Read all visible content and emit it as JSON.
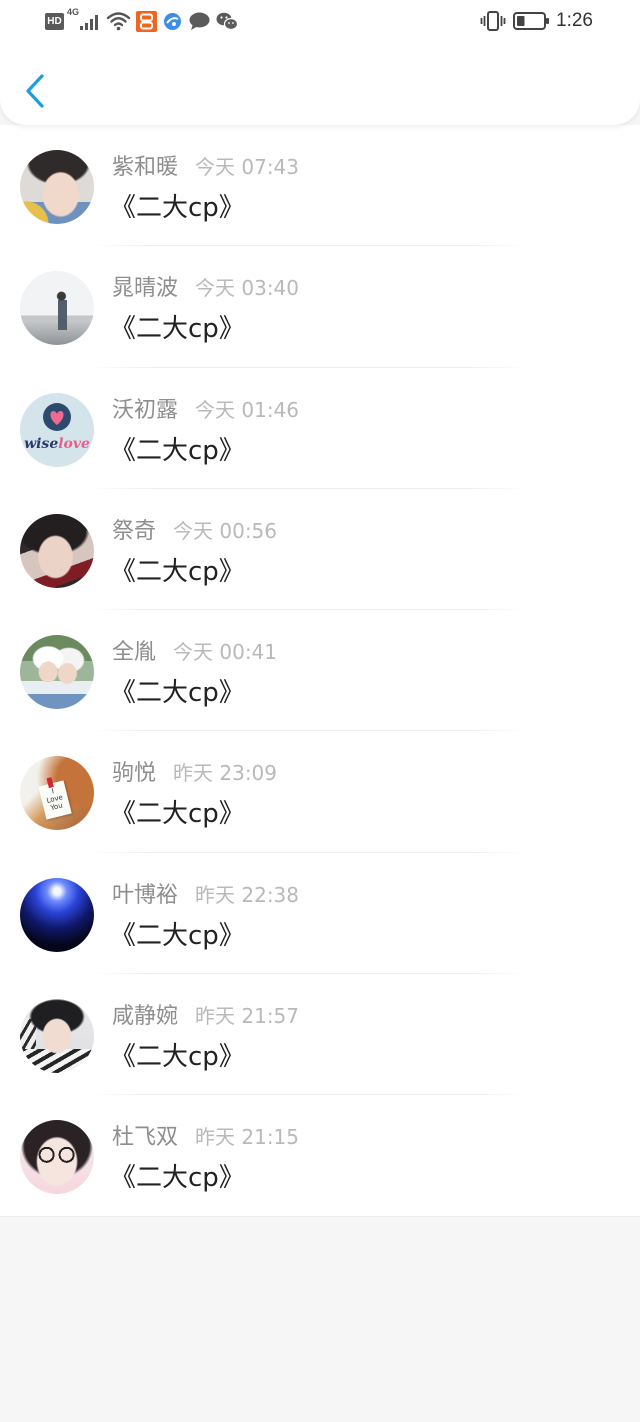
{
  "status_bar": {
    "hd_label": "HD",
    "network_label": "4G",
    "time": "1:26",
    "battery_level": 0.3
  },
  "header": {
    "back_icon": "chevron-left-icon"
  },
  "colors": {
    "accent": "#1c9ddf",
    "name": "#8e8e8e",
    "time": "#b9b9b9",
    "message": "#222222",
    "page_bg": "#f7f6f6"
  },
  "messages": [
    {
      "name": "紫和暖",
      "time": "今天 07:43",
      "text": "《二大cp》"
    },
    {
      "name": "晁晴波",
      "time": "今天 03:40",
      "text": "《二大cp》"
    },
    {
      "name": "沃初露",
      "time": "今天 01:46",
      "text": "《二大cp》",
      "avatar_logo": {
        "part1": "wise",
        "part2": "love"
      }
    },
    {
      "name": "祭奇",
      "time": "今天 00:56",
      "text": "《二大cp》"
    },
    {
      "name": "全胤",
      "time": "今天 00:41",
      "text": "《二大cp》"
    },
    {
      "name": "驹悦",
      "time": "昨天 23:09",
      "text": "《二大cp》",
      "avatar_note": [
        "I",
        "Love",
        "You"
      ]
    },
    {
      "name": "叶博裕",
      "time": "昨天 22:38",
      "text": "《二大cp》"
    },
    {
      "name": "咸静婉",
      "time": "昨天 21:57",
      "text": "《二大cp》"
    },
    {
      "name": "杜飞双",
      "time": "昨天 21:15",
      "text": "《二大cp》"
    }
  ]
}
